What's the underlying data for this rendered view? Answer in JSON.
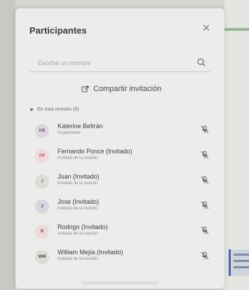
{
  "panel": {
    "title": "Participantes",
    "close_icon": "close-icon"
  },
  "search": {
    "placeholder": "Escribe un nombre",
    "icon": "search-icon"
  },
  "share": {
    "label": "Compartir invitación",
    "icon": "share-icon"
  },
  "section": {
    "label": "En esta reunión (6)"
  },
  "participants": [
    {
      "initials": "KB",
      "name": "Katerine Beltrán",
      "role": "Organizador",
      "avatar_bg": "#ddd6df",
      "avatar_fg": "#7d4f79"
    },
    {
      "initials": "FP",
      "name": "Fernando Ponce (Invitado)",
      "role": "Invitado de la reunión",
      "avatar_bg": "#f0d8de",
      "avatar_fg": "#b5465e"
    },
    {
      "initials": "J",
      "name": "Juan (Invitado)",
      "role": "Invitado de la reunión",
      "avatar_bg": "#dcddd5",
      "avatar_fg": "#6b6f5a"
    },
    {
      "initials": "J",
      "name": "Jose (Invitado)",
      "role": "Invitado de la reunión",
      "avatar_bg": "#d6d7df",
      "avatar_fg": "#434a6b"
    },
    {
      "initials": "R",
      "name": "Rodrigo (Invitado)",
      "role": "Invitado de la reunión",
      "avatar_bg": "#ecd9dc",
      "avatar_fg": "#8e3a49"
    },
    {
      "initials": "WM",
      "name": "William Mejía (Invitado)",
      "role": "Invitado de la reunión",
      "avatar_bg": "#dcdbd6",
      "avatar_fg": "#4b4a44"
    }
  ],
  "colors": {
    "accent": "#4c63a8",
    "panel": "#ececea"
  }
}
